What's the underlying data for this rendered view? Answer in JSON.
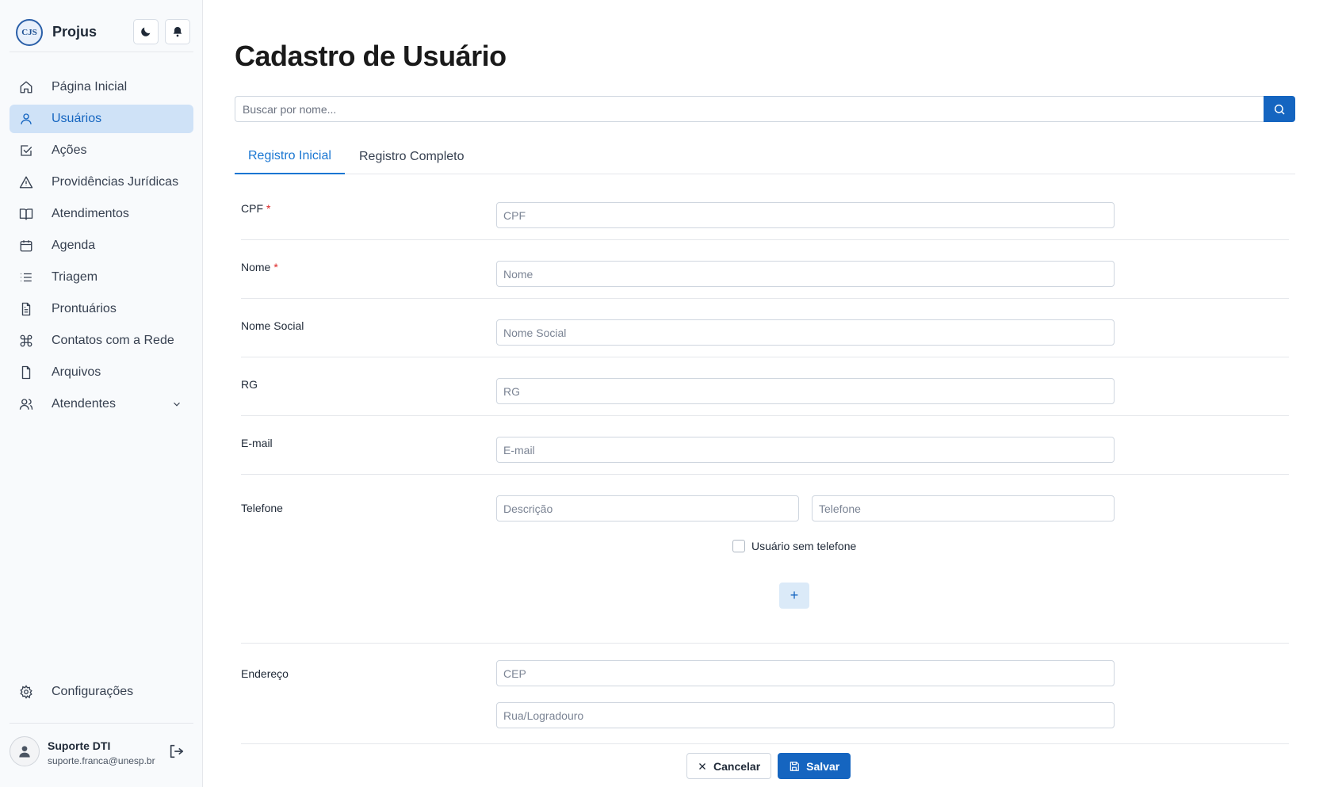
{
  "app": {
    "name": "Projus",
    "logo_text": "CJS"
  },
  "sidebar": {
    "items": [
      {
        "label": "Página Inicial",
        "icon": "home-icon"
      },
      {
        "label": "Usuários",
        "icon": "user-icon",
        "active": true
      },
      {
        "label": "Ações",
        "icon": "checkbox-icon"
      },
      {
        "label": "Providências Jurídicas",
        "icon": "warning-icon"
      },
      {
        "label": "Atendimentos",
        "icon": "book-icon"
      },
      {
        "label": "Agenda",
        "icon": "calendar-icon"
      },
      {
        "label": "Triagem",
        "icon": "list-icon"
      },
      {
        "label": "Prontuários",
        "icon": "document-icon"
      },
      {
        "label": "Contatos com a Rede",
        "icon": "command-icon"
      },
      {
        "label": "Arquivos",
        "icon": "file-icon"
      },
      {
        "label": "Atendentes",
        "icon": "users-icon",
        "expandable": true
      }
    ],
    "settings_label": "Configurações"
  },
  "user": {
    "name": "Suporte DTI",
    "email": "suporte.franca@unesp.br"
  },
  "page": {
    "title": "Cadastro de Usuário",
    "search_placeholder": "Buscar por nome..."
  },
  "tabs": [
    {
      "label": "Registro Inicial",
      "active": true
    },
    {
      "label": "Registro Completo",
      "active": false
    }
  ],
  "form": {
    "cpf": {
      "label": "CPF",
      "required_mark": "*",
      "placeholder": "CPF"
    },
    "nome": {
      "label": "Nome",
      "required_mark": "*",
      "placeholder": "Nome"
    },
    "nome_social": {
      "label": "Nome Social",
      "placeholder": "Nome Social"
    },
    "rg": {
      "label": "RG",
      "placeholder": "RG"
    },
    "email": {
      "label": "E-mail",
      "placeholder": "E-mail"
    },
    "telefone": {
      "label": "Telefone",
      "descricao_placeholder": "Descrição",
      "telefone_placeholder": "Telefone",
      "no_phone_label": "Usuário sem telefone",
      "add_label": "+"
    },
    "endereco": {
      "label": "Endereço",
      "cep_placeholder": "CEP",
      "rua_placeholder": "Rua/Logradouro"
    }
  },
  "actions": {
    "cancel_label": "Cancelar",
    "save_label": "Salvar"
  },
  "colors": {
    "primary": "#1565c0",
    "active_nav_bg": "#cfe2f7",
    "required": "#dc2626"
  }
}
